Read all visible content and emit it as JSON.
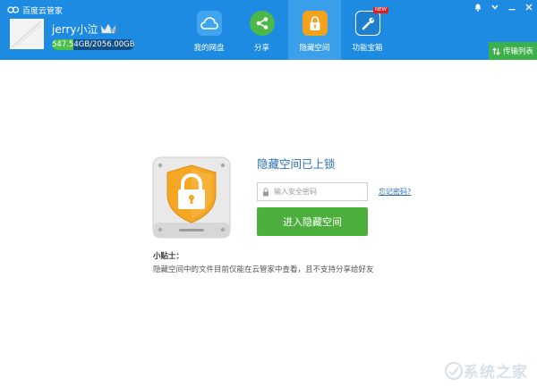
{
  "app": {
    "title": "百度云管家"
  },
  "user": {
    "name": "jerry小泣",
    "vip_badge": "VIP",
    "quota_text": "547.54GB/2056.00GB",
    "quota_used_fraction": 0.266
  },
  "nav": {
    "items": [
      {
        "label": "我的网盘",
        "icon": "cloud-icon",
        "color": "#3fa5f0"
      },
      {
        "label": "分享",
        "icon": "share-icon",
        "color": "#4cb848"
      },
      {
        "label": "隐藏空间",
        "icon": "lock-icon",
        "color": "#f4a11c",
        "active": true
      },
      {
        "label": "功能宝箱",
        "icon": "wrench-icon",
        "color": "#1f7fcf",
        "badge": "NEW"
      }
    ]
  },
  "transfer": {
    "label": "传输列表",
    "icon": "transfer-icon"
  },
  "hidden_space": {
    "title": "隐藏空间已上锁",
    "password_placeholder": "输入安全密码",
    "forgot_label": "忘记密码?",
    "enter_label": "进入隐藏空间",
    "tips_title": "小贴士：",
    "tips_text": "隐藏空间中的文件目前仅能在云管家中查看，且不支持分享给好友"
  },
  "watermark": {
    "text": "系统之家"
  },
  "colors": {
    "header": "#1d8be2",
    "active_tab": "#3aa0ea",
    "accent_green": "#4caf3c",
    "link": "#2a6fb3",
    "shield": "#f4a11c"
  }
}
